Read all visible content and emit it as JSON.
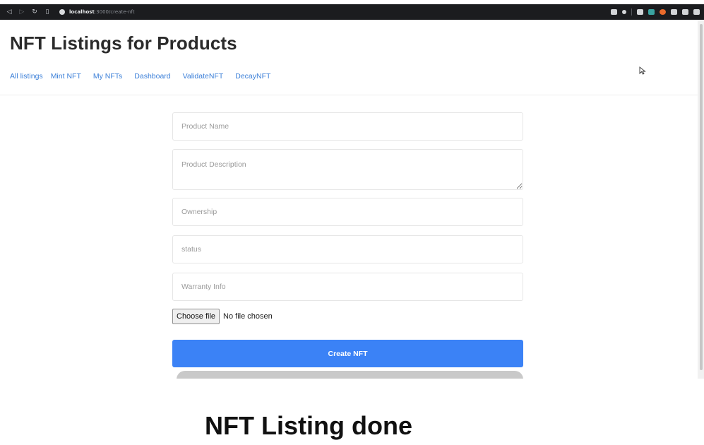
{
  "browser": {
    "url_host": "localhost",
    "url_path": ":3000/create-nft"
  },
  "page": {
    "title": "NFT Listings for Products",
    "nav": [
      {
        "label": "All listings"
      },
      {
        "label": "Mint NFT"
      },
      {
        "label": "My NFTs"
      },
      {
        "label": "Dashboard"
      },
      {
        "label": "ValidateNFT"
      },
      {
        "label": "DecayNFT"
      }
    ]
  },
  "form": {
    "product_name_placeholder": "Product Name",
    "product_description_placeholder": "Product Description",
    "ownership_placeholder": "Ownership",
    "status_placeholder": "status",
    "warranty_placeholder": "Warranty Info",
    "choose_file_label": "Choose file",
    "no_file_text": "No file chosen",
    "create_button_label": "Create NFT"
  },
  "caption": "NFT Listing done",
  "colors": {
    "accent": "#3b82f6",
    "link": "#3b7fd8",
    "browser_bar": "#1b1c1f"
  }
}
